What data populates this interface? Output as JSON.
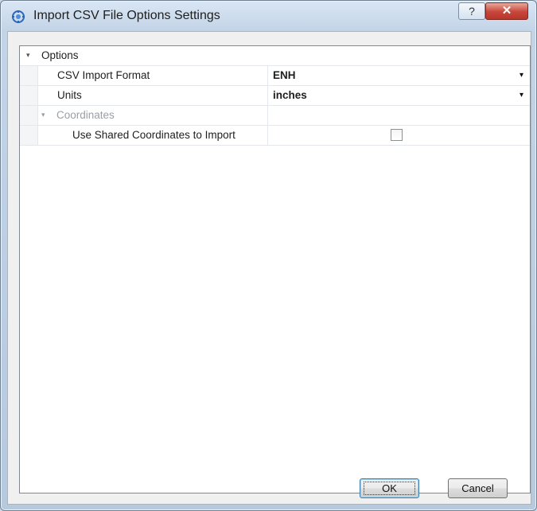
{
  "window": {
    "title": "Import CSV File Options Settings",
    "help_label": "?",
    "close_label": "✕"
  },
  "grid": {
    "category": "Options",
    "rows": [
      {
        "label": "CSV Import Format",
        "value": "ENH"
      },
      {
        "label": "Units",
        "value": "inches"
      }
    ],
    "subcategory": "Coordinates",
    "shared_coords": {
      "label": "Use Shared Coordinates to Import",
      "checked": false
    }
  },
  "buttons": {
    "ok_label": "OK",
    "cancel_label": "Cancel"
  },
  "icons": {
    "expander": "▾",
    "dropdown": "▾"
  }
}
